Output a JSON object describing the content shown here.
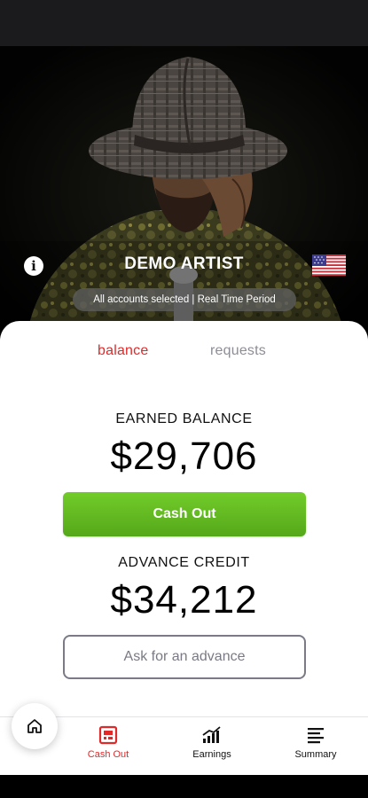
{
  "header": {
    "artist_name": "DEMO ARTIST",
    "filter_text": "All accounts selected | Real Time Period"
  },
  "icons": {
    "info": "info-icon",
    "flag": "us-flag-icon",
    "home": "home-icon",
    "cash_out": "cash-register-icon",
    "earnings": "bar-chart-icon",
    "summary": "list-icon"
  },
  "tabs": {
    "balance": "balance",
    "requests": "requests"
  },
  "balance": {
    "earned_label": "EARNED BALANCE",
    "earned_amount": "$29,706",
    "cash_out_label": "Cash Out",
    "advance_label": "ADVANCE CREDIT",
    "advance_amount": "$34,212",
    "ask_advance_label": "Ask for an advance"
  },
  "nav": {
    "cash_out": "Cash Out",
    "earnings": "Earnings",
    "summary": "Summary"
  },
  "colors": {
    "accent_red": "#e02a2a",
    "cash_out_green": "#62b822",
    "muted_gray": "#8d8d95"
  }
}
